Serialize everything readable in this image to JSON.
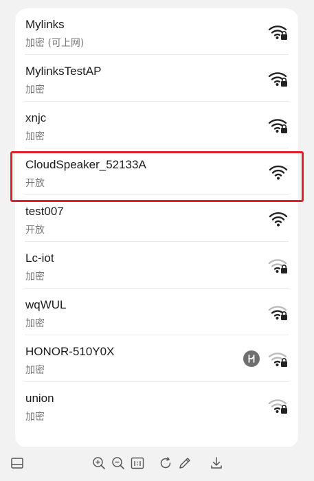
{
  "networks": [
    {
      "ssid": "Mylinks",
      "security": "加密 (可上网)",
      "signal_icon": "wifi-locked-strong-icon",
      "signal": "strong",
      "locked": true
    },
    {
      "ssid": "MylinksTestAP",
      "security": "加密",
      "signal_icon": "wifi-locked-strong-icon",
      "signal": "strong",
      "locked": true
    },
    {
      "ssid": "xnjc",
      "security": "加密",
      "signal_icon": "wifi-locked-strong-icon",
      "signal": "strong",
      "locked": true
    },
    {
      "ssid": "CloudSpeaker_52133A",
      "security": "开放",
      "signal_icon": "wifi-strong-icon",
      "signal": "strong",
      "locked": false,
      "highlighted": true
    },
    {
      "ssid": "test007",
      "security": "开放",
      "signal_icon": "wifi-strong-icon",
      "signal": "strong",
      "locked": false
    },
    {
      "ssid": "Lc-iot",
      "security": "加密",
      "signal_icon": "wifi-locked-weak-icon",
      "signal": "weak",
      "locked": true
    },
    {
      "ssid": "wqWUL",
      "security": "加密",
      "signal_icon": "wifi-locked-medium-icon",
      "signal": "medium",
      "locked": true
    },
    {
      "ssid": "HONOR-510Y0X",
      "security": "加密",
      "signal_icon": "wifi-locked-weak-icon",
      "signal": "weak",
      "locked": true,
      "extra_icon": "honor-link-icon"
    },
    {
      "ssid": "union",
      "security": "加密",
      "signal_icon": "wifi-locked-weak-icon",
      "signal": "weak",
      "locked": true
    }
  ],
  "highlight_color": "#e0202a",
  "toolbar": {
    "icons": [
      "panel-toggle-icon",
      "zoom-in-icon",
      "zoom-out-icon",
      "actual-size-icon",
      "rotate-icon",
      "edit-pen-icon",
      "download-icon"
    ]
  }
}
